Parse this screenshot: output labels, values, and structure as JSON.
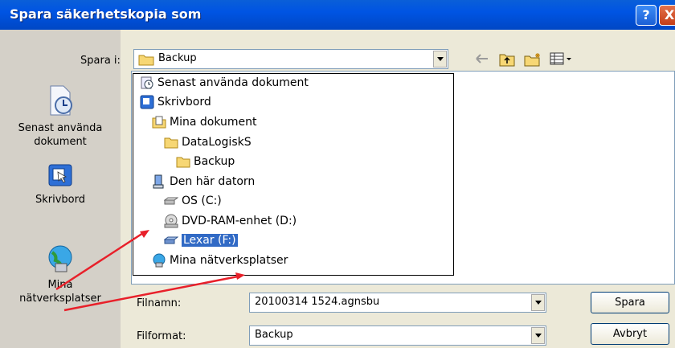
{
  "window": {
    "title": "Spara säkerhetskopia som",
    "help_glyph": "?",
    "close_glyph": "X"
  },
  "save_in": {
    "label": "Spara i:",
    "value": "Backup"
  },
  "places_bar": [
    {
      "label": "Senast använda\ndokument",
      "icon": "recent-documents-icon"
    },
    {
      "label": "Skrivbord",
      "icon": "desktop-icon"
    },
    {
      "label": "Mina\nnätverksplatser",
      "icon": "network-places-icon"
    }
  ],
  "dropdown_items": [
    {
      "label": "Senast använda dokument",
      "icon": "recent-icon",
      "level": 0,
      "selected": false
    },
    {
      "label": "Skrivbord",
      "icon": "desktop-icon",
      "level": 0,
      "selected": false
    },
    {
      "label": "Mina dokument",
      "icon": "my-documents-icon",
      "level": 1,
      "selected": false
    },
    {
      "label": "DataLogiskS",
      "icon": "folder-icon",
      "level": 2,
      "selected": false
    },
    {
      "label": "Backup",
      "icon": "folder-icon",
      "level": 3,
      "selected": false
    },
    {
      "label": "Den här datorn",
      "icon": "my-computer-icon",
      "level": 1,
      "selected": false
    },
    {
      "label": "OS (C:)",
      "icon": "hard-drive-icon",
      "level": 2,
      "selected": false
    },
    {
      "label": "DVD-RAM-enhet (D:)",
      "icon": "dvd-drive-icon",
      "level": 2,
      "selected": false
    },
    {
      "label": "Lexar (F:)",
      "icon": "removable-drive-icon",
      "level": 2,
      "selected": true
    },
    {
      "label": "Mina nätverksplatser",
      "icon": "network-places-icon",
      "level": 1,
      "selected": false
    }
  ],
  "filename": {
    "label": "Filnamn:",
    "value": "20100314 1524.agnsbu"
  },
  "format": {
    "label": "Filformat:",
    "value": "Backup"
  },
  "buttons": {
    "save": "Spara",
    "cancel": "Avbryt"
  }
}
